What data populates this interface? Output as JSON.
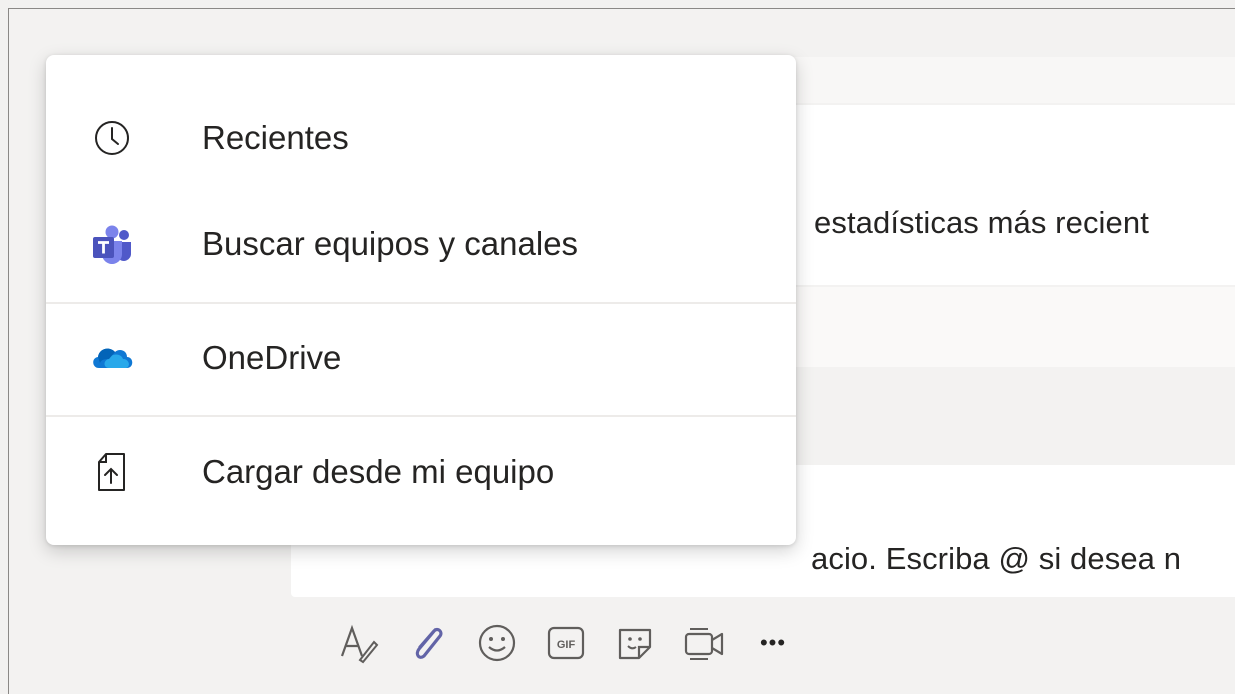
{
  "menu": {
    "items": [
      {
        "label": "Recientes",
        "icon": "clock-icon"
      },
      {
        "label": "Buscar equipos y canales",
        "icon": "teams-icon"
      },
      {
        "label": "OneDrive",
        "icon": "onedrive-icon"
      },
      {
        "label": "Cargar desde mi equipo",
        "icon": "upload-file-icon"
      }
    ]
  },
  "conversation": {
    "message_fragment": "estadísticas más recient",
    "compose_placeholder_fragment": "acio. Escriba @ si desea n"
  },
  "toolbar": {
    "icons": [
      "format-icon",
      "attach-icon",
      "emoji-icon",
      "gif-icon",
      "sticker-icon",
      "meet-now-icon",
      "more-options-icon"
    ],
    "gif_label": "GIF",
    "more_label": "•••"
  },
  "colors": {
    "accent": "#6264a7",
    "teams_purple": "#5059c9",
    "onedrive_blue": "#0f78d4",
    "text": "#252423",
    "background": "#f3f2f1"
  }
}
